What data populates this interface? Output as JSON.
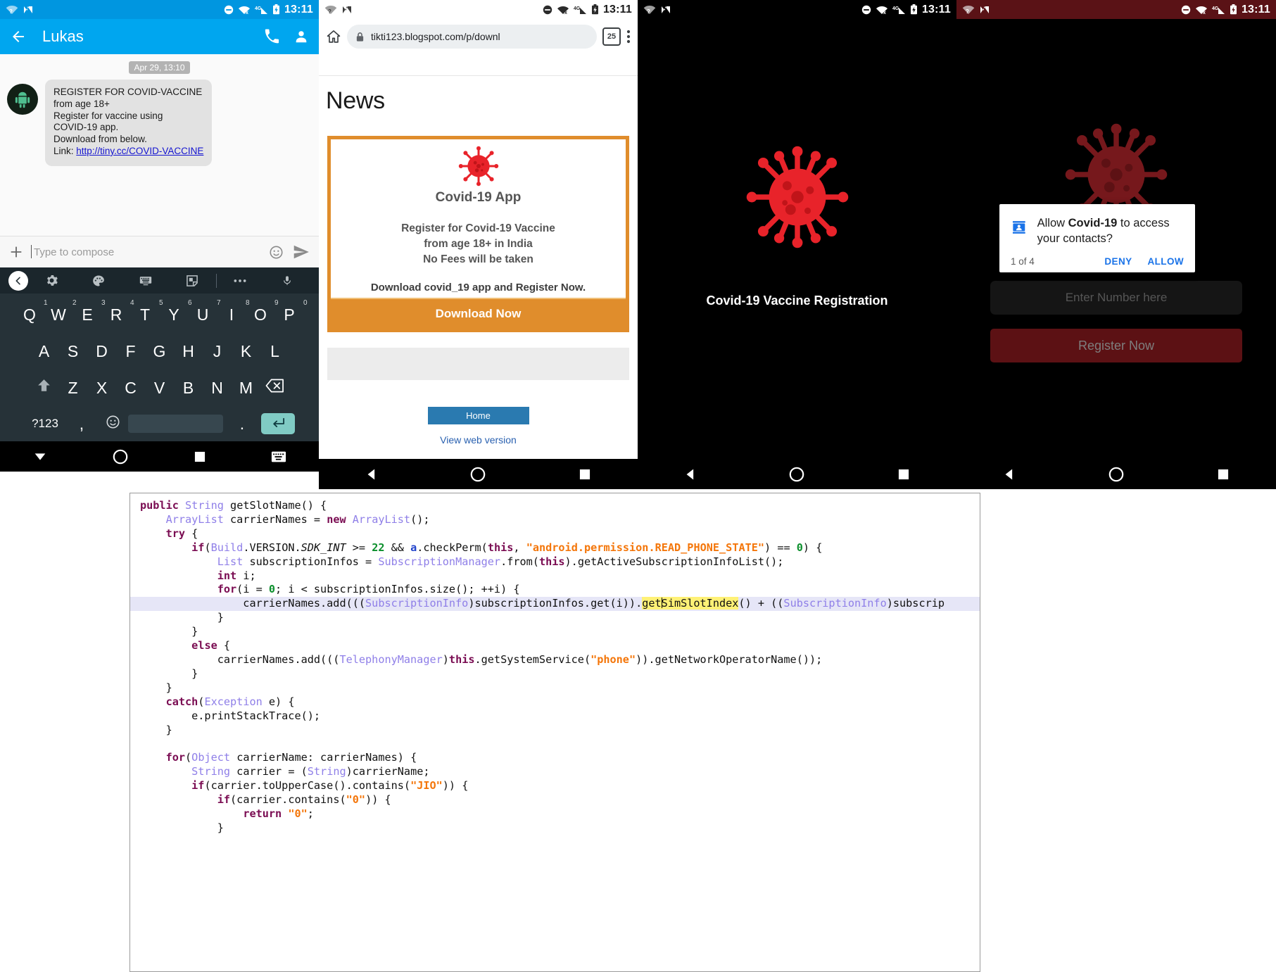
{
  "status_bar": {
    "time": "13:11",
    "icons": [
      "wifi-question-icon",
      "n-logo-icon",
      "do-not-disturb-icon",
      "wifi-off-icon",
      "signal-4g-icon",
      "battery-charging-icon"
    ]
  },
  "phone1": {
    "app_bar": {
      "title": "Lukas",
      "back": "back-arrow-icon",
      "call": "phone-icon",
      "contact": "person-icon"
    },
    "thread": {
      "timestamp": "Apr 29, 13:10",
      "message_lines": [
        "REGISTER FOR COVID-VACCINE",
        "from age 18+",
        "Register for vaccine using",
        "COVID-19 app.",
        "Download from below."
      ],
      "link_label": "Link:",
      "link_text": "http://tiny.cc/COVID-VACCINE"
    },
    "composer": {
      "placeholder": "Type to compose",
      "add": "plus-icon",
      "emoji": "emoji-icon",
      "send": "send-icon"
    },
    "keyboard": {
      "toolbar": [
        "chevron-left-icon",
        "gear-icon",
        "palette-icon",
        "keyboard-icon",
        "sticker-icon",
        "overflow-icon",
        "mic-icon"
      ],
      "row1": [
        {
          "letter": "Q",
          "num": "1"
        },
        {
          "letter": "W",
          "num": "2"
        },
        {
          "letter": "E",
          "num": "3"
        },
        {
          "letter": "R",
          "num": "4"
        },
        {
          "letter": "T",
          "num": "5"
        },
        {
          "letter": "Y",
          "num": "6"
        },
        {
          "letter": "U",
          "num": "7"
        },
        {
          "letter": "I",
          "num": "8"
        },
        {
          "letter": "O",
          "num": "9"
        },
        {
          "letter": "P",
          "num": "0"
        }
      ],
      "row2": [
        "A",
        "S",
        "D",
        "F",
        "G",
        "H",
        "J",
        "K",
        "L"
      ],
      "row3": [
        "Z",
        "X",
        "C",
        "V",
        "B",
        "N",
        "M"
      ],
      "shift": "shift-icon",
      "backspace": "backspace-icon",
      "symbols": "?123",
      "comma": ",",
      "emoji": "emoji-key-icon",
      "period": ".",
      "enter": "enter-icon"
    },
    "nav": [
      "down-chevron-icon",
      "home-circle-icon",
      "recents-square-icon",
      "keyboard-switch-icon"
    ]
  },
  "phone2": {
    "chrome": {
      "home": "home-icon",
      "lock": "lock-icon",
      "url": "tikti123.blogspot.com/p/downl",
      "tab_count": "25",
      "menu": "overflow-icon"
    },
    "page": {
      "heading": "News",
      "card_title": "Covid-19 App",
      "card_body_lines": [
        "Register for Covid-19 Vaccine",
        "from age 18+ in India",
        "No Fees will be taken"
      ],
      "card_sub": "Download covid_19 app and Register Now.",
      "download_button": "Download Now",
      "home_button": "Home",
      "view_web": "View web version"
    },
    "nav": [
      "back-triangle-icon",
      "home-circle-icon",
      "recents-square-icon"
    ]
  },
  "phone3": {
    "splash_title": "Covid-19 Vaccine Registration",
    "icon": "coronavirus-icon",
    "nav": [
      "back-triangle-icon",
      "home-circle-icon",
      "recents-square-icon"
    ]
  },
  "phone4": {
    "field_placeholder": "Enter Number here",
    "register_button": "Register Now",
    "dialog": {
      "icon": "contacts-icon",
      "text_prefix": "Allow ",
      "app_name": "Covid-19",
      "text_suffix": " to access your contacts?",
      "line1_rest": "",
      "counter": "1 of 4",
      "deny": "DENY",
      "allow": "ALLOW"
    },
    "nav": [
      "back-triangle-icon",
      "home-circle-icon",
      "recents-square-icon"
    ]
  },
  "code": {
    "language": "java",
    "lines": [
      "public String getSlotName() {",
      "    ArrayList carrierNames = new ArrayList();",
      "    try {",
      "        if(Build.VERSION.SDK_INT >= 22 && a.checkPerm(this, \"android.permission.READ_PHONE_STATE\") == 0) {",
      "            List subscriptionInfos = SubscriptionManager.from(this).getActiveSubscriptionInfoList();",
      "            int i;",
      "            for(i = 0; i < subscriptionInfos.size(); ++i) {",
      "                carrierNames.add(((SubscriptionInfo)subscriptionInfos.get(i)).getSimSlotIndex() + ((SubscriptionInfo)subscrip",
      "            }",
      "        }",
      "        else {",
      "            carrierNames.add(((TelephonyManager)this.getSystemService(\"phone\")).getNetworkOperatorName());",
      "        }",
      "    }",
      "    catch(Exception e) {",
      "        e.printStackTrace();",
      "    }",
      "",
      "    for(Object carrierName: carrierNames) {",
      "        String carrier = (String)carrierName;",
      "        if(carrier.toUpperCase().contains(\"JIO\")) {",
      "            if(carrier.contains(\"0\")) {",
      "                return \"0\";",
      "            }"
    ],
    "highlighted_line_index": 7,
    "highlighted_token": "getSimSlotIndex"
  },
  "colors": {
    "sms_accent": "#00a6ef",
    "orange": "#e08d2c",
    "virus_red": "#e8232a",
    "dialog_blue": "#1a73e8",
    "dark_red_statusbar": "#5a1216"
  }
}
